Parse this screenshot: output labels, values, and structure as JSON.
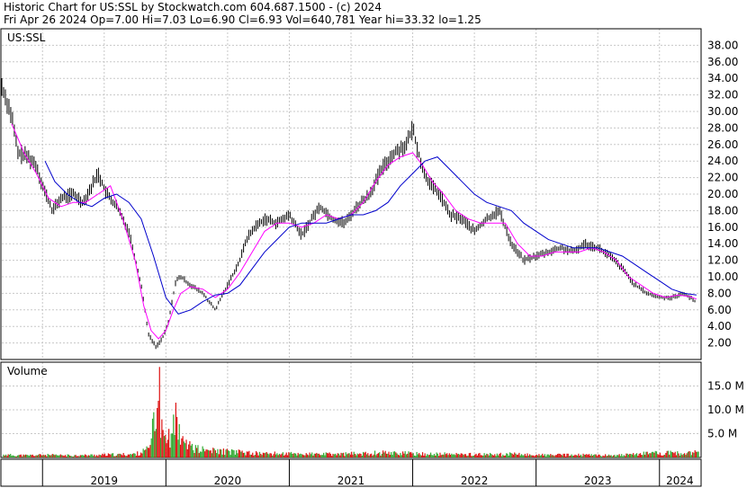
{
  "header": {
    "line1": "Historic Chart for US:SSL by Stockwatch.com 604.687.1500 - (c) 2024",
    "line2": "Fri Apr 26 2024   Op=7.00  Hi=7.03  Lo=6.90  Cl=6.93  Vol=640,781  Year hi=33.32  lo=1.25"
  },
  "colors": {
    "price_ma_short": "#ff00ff",
    "price_ma_long": "#0000cc",
    "candles": "#000000",
    "volume_up": "#33aa33",
    "volume_down": "#dd1111"
  },
  "chart_data": [
    {
      "type": "line",
      "panel_label": "US:SSL",
      "x_unit": "year",
      "x_tick_labels": [
        "2019",
        "2020",
        "2021",
        "2022",
        "2023",
        "2024"
      ],
      "x_ticks": [
        2019.0,
        2020.0,
        2021.0,
        2022.0,
        2023.0,
        2024.0
      ],
      "xlim": [
        2018.67,
        2024.33
      ],
      "y_tick_labels": [
        "2.00",
        "4.00",
        "6.00",
        "8.00",
        "10.00",
        "12.00",
        "14.00",
        "16.00",
        "18.00",
        "20.00",
        "22.00",
        "24.00",
        "26.00",
        "28.00",
        "30.00",
        "32.00",
        "34.00",
        "36.00",
        "38.00"
      ],
      "ylim": [
        0,
        40
      ],
      "grid": true,
      "series": [
        {
          "role": "price",
          "x": [
            2018.67,
            2018.75,
            2018.8,
            2018.88,
            2018.95,
            2019.0,
            2019.08,
            2019.15,
            2019.25,
            2019.33,
            2019.4,
            2019.45,
            2019.52,
            2019.6,
            2019.7,
            2019.8,
            2019.86,
            2019.92,
            2019.98,
            2020.02,
            2020.08,
            2020.12,
            2020.2,
            2020.3,
            2020.4,
            2020.5,
            2020.6,
            2020.65,
            2020.72,
            2020.8,
            2020.9,
            2021.0,
            2021.1,
            2021.2,
            2021.25,
            2021.35,
            2021.45,
            2021.55,
            2021.65,
            2021.75,
            2021.85,
            2021.95,
            2022.0,
            2022.08,
            2022.15,
            2022.22,
            2022.3,
            2022.4,
            2022.5,
            2022.6,
            2022.7,
            2022.8,
            2022.9,
            2023.0,
            2023.1,
            2023.2,
            2023.3,
            2023.4,
            2023.5,
            2023.6,
            2023.7,
            2023.8,
            2023.9,
            2024.0,
            2024.1,
            2024.2,
            2024.3
          ],
          "y": [
            33.0,
            29.5,
            25.0,
            24.5,
            23.5,
            21.0,
            18.0,
            19.5,
            20.0,
            19.0,
            21.0,
            22.5,
            20.0,
            18.5,
            15.5,
            9.0,
            3.0,
            1.5,
            2.8,
            4.5,
            9.5,
            10.0,
            9.0,
            8.0,
            6.0,
            9.0,
            12.0,
            14.5,
            16.0,
            17.0,
            16.5,
            17.5,
            15.0,
            17.5,
            18.5,
            17.0,
            16.5,
            18.5,
            20.0,
            23.0,
            25.0,
            26.0,
            28.0,
            23.0,
            21.0,
            20.0,
            17.5,
            17.0,
            15.5,
            17.0,
            18.0,
            14.0,
            12.0,
            12.5,
            13.0,
            13.5,
            13.0,
            14.0,
            13.5,
            12.5,
            11.0,
            9.0,
            8.0,
            7.5,
            7.5,
            8.0,
            6.9
          ]
        },
        {
          "role": "short moving average",
          "x": [
            2018.75,
            2018.85,
            2018.95,
            2019.05,
            2019.15,
            2019.25,
            2019.35,
            2019.45,
            2019.55,
            2019.65,
            2019.75,
            2019.82,
            2019.88,
            2019.94,
            2020.0,
            2020.06,
            2020.12,
            2020.2,
            2020.3,
            2020.4,
            2020.5,
            2020.6,
            2020.7,
            2020.8,
            2020.9,
            2021.0,
            2021.1,
            2021.2,
            2021.3,
            2021.4,
            2021.5,
            2021.6,
            2021.7,
            2021.8,
            2021.9,
            2022.0,
            2022.08,
            2022.16,
            2022.25,
            2022.35,
            2022.45,
            2022.55,
            2022.65,
            2022.75,
            2022.85,
            2022.95,
            2023.05,
            2023.15,
            2023.25,
            2023.35,
            2023.45,
            2023.55,
            2023.65,
            2023.75,
            2023.85,
            2023.95,
            2024.05,
            2024.15,
            2024.25,
            2024.3
          ],
          "y": [
            28.5,
            25.0,
            22.5,
            19.5,
            18.5,
            19.0,
            19.0,
            20.0,
            21.0,
            17.0,
            12.0,
            6.5,
            3.5,
            2.5,
            3.5,
            6.0,
            8.0,
            8.8,
            8.5,
            7.5,
            8.5,
            10.5,
            13.0,
            15.5,
            16.5,
            16.5,
            16.0,
            16.5,
            17.5,
            17.0,
            17.5,
            19.0,
            21.5,
            23.5,
            24.5,
            25.0,
            23.5,
            21.5,
            20.0,
            18.0,
            17.0,
            16.5,
            16.5,
            16.5,
            14.0,
            12.5,
            12.5,
            13.0,
            13.0,
            13.0,
            13.5,
            13.0,
            12.0,
            10.0,
            9.0,
            8.0,
            7.5,
            7.8,
            7.6,
            7.3
          ]
        },
        {
          "role": "long moving average",
          "x": [
            2019.02,
            2019.1,
            2019.2,
            2019.3,
            2019.4,
            2019.5,
            2019.6,
            2019.7,
            2019.8,
            2019.9,
            2020.0,
            2020.1,
            2020.2,
            2020.3,
            2020.4,
            2020.5,
            2020.6,
            2020.7,
            2020.8,
            2020.9,
            2021.0,
            2021.1,
            2021.2,
            2021.3,
            2021.4,
            2021.5,
            2021.6,
            2021.7,
            2021.8,
            2021.9,
            2022.0,
            2022.1,
            2022.2,
            2022.3,
            2022.4,
            2022.5,
            2022.6,
            2022.7,
            2022.8,
            2022.9,
            2023.0,
            2023.1,
            2023.2,
            2023.3,
            2023.4,
            2023.5,
            2023.6,
            2023.7,
            2023.8,
            2023.9,
            2024.0,
            2024.1,
            2024.2,
            2024.3
          ],
          "y": [
            24.0,
            21.5,
            20.0,
            19.0,
            18.5,
            19.5,
            20.0,
            19.0,
            17.0,
            12.5,
            7.5,
            5.5,
            6.0,
            7.0,
            7.8,
            8.0,
            9.0,
            11.0,
            13.0,
            14.5,
            16.0,
            16.5,
            16.5,
            16.5,
            17.0,
            17.5,
            17.5,
            18.0,
            19.0,
            21.0,
            22.5,
            24.0,
            24.5,
            23.0,
            21.5,
            20.0,
            19.0,
            18.5,
            18.0,
            16.5,
            15.5,
            14.5,
            14.0,
            13.5,
            13.5,
            13.5,
            13.0,
            12.5,
            11.5,
            10.5,
            9.5,
            8.5,
            8.0,
            7.8
          ]
        }
      ]
    },
    {
      "type": "bar",
      "panel_label": "Volume",
      "unit": "M",
      "y_tick_labels": [
        "5.0 M",
        "10.0 M",
        "15.0 M"
      ],
      "ylim": [
        0,
        20
      ],
      "x": [
        2018.7,
        2018.85,
        2019.0,
        2019.15,
        2019.3,
        2019.45,
        2019.6,
        2019.75,
        2019.86,
        2019.88,
        2019.9,
        2019.92,
        2019.94,
        2019.96,
        2019.98,
        2020.0,
        2020.02,
        2020.04,
        2020.06,
        2020.08,
        2020.1,
        2020.12,
        2020.15,
        2020.2,
        2020.25,
        2020.3,
        2020.4,
        2020.5,
        2020.6,
        2020.7,
        2020.8,
        2020.9,
        2021.0,
        2021.2,
        2021.4,
        2021.6,
        2021.8,
        2022.0,
        2022.2,
        2022.4,
        2022.6,
        2022.8,
        2023.0,
        2023.2,
        2023.4,
        2023.6,
        2023.8,
        2023.9,
        2024.0,
        2024.1,
        2024.2,
        2024.3
      ],
      "values": [
        0.6,
        0.5,
        0.6,
        0.5,
        0.5,
        0.6,
        0.7,
        0.8,
        2.0,
        4.0,
        9.5,
        6.0,
        19.0,
        8.0,
        4.5,
        3.0,
        6.0,
        5.0,
        9.0,
        11.5,
        7.0,
        4.0,
        3.0,
        2.5,
        2.0,
        1.8,
        1.5,
        1.5,
        1.2,
        1.0,
        1.0,
        0.9,
        0.9,
        0.8,
        0.8,
        1.0,
        1.2,
        0.9,
        0.8,
        0.8,
        0.7,
        0.8,
        0.6,
        0.6,
        0.6,
        0.5,
        0.7,
        1.2,
        1.0,
        1.1,
        0.9,
        1.2
      ],
      "direction": [
        "up",
        "down",
        "up",
        "down",
        "up",
        "down",
        "down",
        "down",
        "down",
        "up",
        "down",
        "up",
        "up",
        "down",
        "down",
        "down",
        "up",
        "down",
        "down",
        "up",
        "down",
        "down",
        "down",
        "up",
        "down",
        "down",
        "down",
        "up",
        "down",
        "down",
        "up",
        "down",
        "down",
        "up",
        "down",
        "up",
        "down",
        "up",
        "down",
        "down",
        "up",
        "down",
        "down",
        "up",
        "down",
        "up",
        "down",
        "down",
        "up",
        "down",
        "down",
        "up"
      ]
    }
  ]
}
